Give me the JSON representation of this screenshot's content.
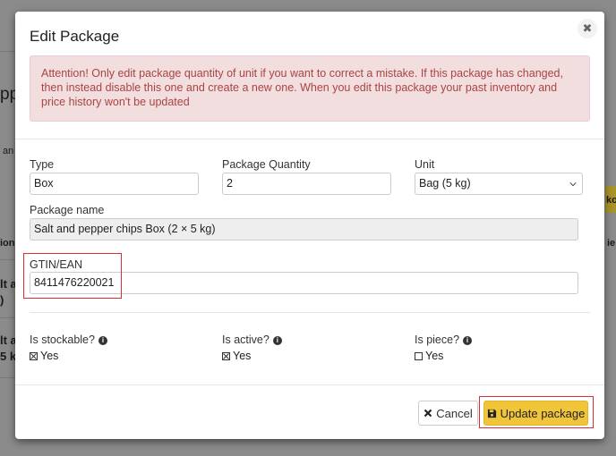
{
  "background": {
    "frag_pp": "pp",
    "frag_an": "an",
    "frag_ion": "ion",
    "frag_lt1": "lt a",
    "frag_paren": ")",
    "frag_lt2": "lt a",
    "frag_kg": "5 kg",
    "frag_ko": "ko",
    "frag_ie": "ie"
  },
  "modal": {
    "title": "Edit Package",
    "alert": "Attention! Only edit package quantity of unit if you want to correct a mistake. If this package has changed, then instead disable this one and create a new one. When you edit this package your past inventory and price history won't be updated",
    "type": {
      "label": "Type",
      "value": "Box"
    },
    "package_quantity": {
      "label": "Package Quantity",
      "value": "2"
    },
    "unit": {
      "label": "Unit",
      "value": "Bag (5 kg)"
    },
    "package_name": {
      "label": "Package name",
      "value": "Salt and pepper chips Box (2 × 5 kg)"
    },
    "gtin": {
      "label": "GTIN/EAN",
      "value": "8411476220021"
    },
    "is_stockable": {
      "label": "Is stockable?",
      "option": "Yes",
      "checked": true
    },
    "is_active": {
      "label": "Is active?",
      "option": "Yes",
      "checked": true
    },
    "is_piece": {
      "label": "Is piece?",
      "option": "Yes",
      "checked": false
    },
    "cancel_label": "Cancel",
    "update_label": "Update package",
    "colors": {
      "alert_bg": "#f2dede",
      "alert_text": "#a94442",
      "primary": "#f0c53a",
      "highlight": "#d9302f"
    }
  }
}
